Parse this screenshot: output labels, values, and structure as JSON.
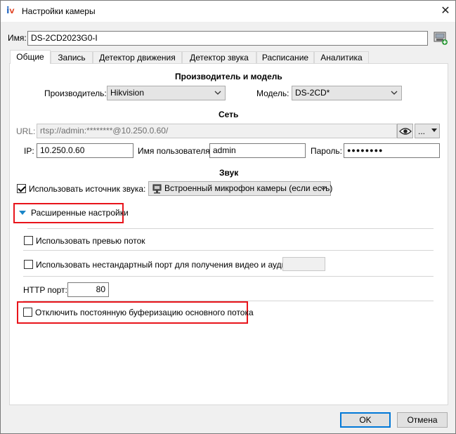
{
  "window": {
    "title": "Настройки камеры",
    "close_symbol": "✕"
  },
  "name": {
    "label": "Имя:",
    "value": "DS-2CD2023G0-I"
  },
  "tabs": [
    {
      "label": "Общие",
      "active": true
    },
    {
      "label": "Запись"
    },
    {
      "label": "Детектор движения"
    },
    {
      "label": "Детектор звука"
    },
    {
      "label": "Расписание"
    },
    {
      "label": "Аналитика"
    }
  ],
  "vendor_section": {
    "title": "Производитель и модель",
    "manufacturer_label": "Производитель:",
    "manufacturer_value": "Hikvision",
    "model_label": "Модель:",
    "model_value": "DS-2CD*"
  },
  "network_section": {
    "title": "Сеть",
    "url_label": "URL:",
    "url_value": "rtsp://admin:********@10.250.0.60/",
    "more_button": "...",
    "ip_label": "IP:",
    "ip_value": "10.250.0.60",
    "username_label": "Имя пользователя:",
    "username_value": "admin",
    "password_label": "Пароль:",
    "password_value": "●●●●●●●●"
  },
  "sound_section": {
    "title": "Звук",
    "use_source_label": "Использовать источник звука:",
    "use_source_checked": true,
    "source_value": "Встроенный микрофон камеры (если есть)"
  },
  "advanced": {
    "toggle_label": "Расширенные настройки",
    "use_preview_label": "Использовать превью поток",
    "nonstandard_port_label": "Использовать нестандартный порт для получения видео и аудио:",
    "http_port_label": "HTTP порт:",
    "http_port_value": "80",
    "disable_buffering_label": "Отключить постоянную буферизацию основного потока"
  },
  "footer": {
    "ok_label": "OK",
    "cancel_label": "Отмена"
  },
  "colors": {
    "highlight_red": "#e8141b",
    "accent_blue": "#0078d7"
  }
}
